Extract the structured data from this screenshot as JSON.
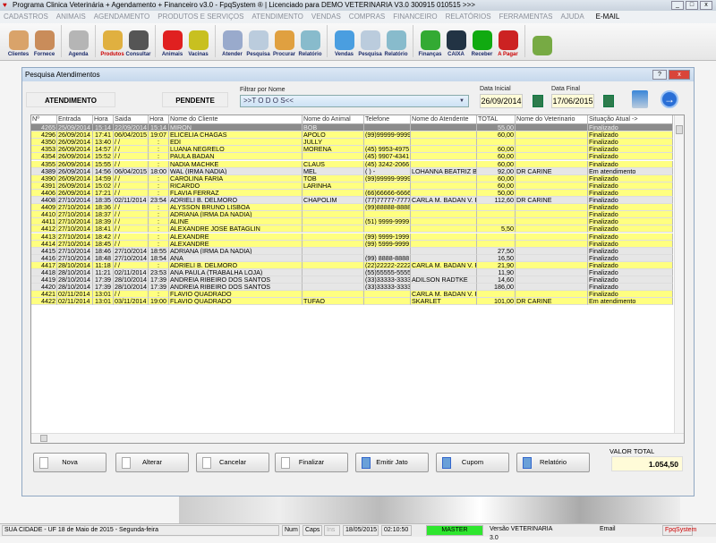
{
  "window": {
    "title": "Programa Clinica Veterinária + Agendamento + Financeiro v3.0 - FpqSystem ® | Licenciado para  DEMO VETERINARIA V3.0 300915 010515 >>>"
  },
  "menu": [
    "CADASTROS",
    "ANIMAIS",
    "AGENDAMENTO",
    "PRODUTOS E SERVIÇOS",
    "ATENDIMENTO",
    "VENDAS",
    "COMPRAS",
    "FINANCEIRO",
    "RELATÓRIOS",
    "FERRAMENTAS",
    "AJUDA"
  ],
  "menu_email": "E-MAIL",
  "toolbar": [
    {
      "label": "Clientes",
      "color": "#d9a36a"
    },
    {
      "label": "Fornece",
      "color": "#c98c5a"
    },
    {
      "sep": true
    },
    {
      "label": "Agenda",
      "color": "#b5b5b5"
    },
    {
      "sep": true
    },
    {
      "label": "Produtos",
      "color": "#e0b040",
      "red": true
    },
    {
      "label": "Consultar",
      "color": "#555"
    },
    {
      "sep": true
    },
    {
      "label": "Animais",
      "color": "#e02020"
    },
    {
      "label": "Vacinas",
      "color": "#c8c020"
    },
    {
      "sep": true
    },
    {
      "label": "Atender",
      "color": "#9ac"
    },
    {
      "label": "Pesquisa",
      "color": "#bcd"
    },
    {
      "label": "Procurar",
      "color": "#e0a040"
    },
    {
      "label": "Relatório",
      "color": "#8bc"
    },
    {
      "sep": true
    },
    {
      "label": "Vendas",
      "color": "#4a9ee0"
    },
    {
      "label": "Pesquisa",
      "color": "#bcd"
    },
    {
      "label": "Relatório",
      "color": "#8bc"
    },
    {
      "sep": true
    },
    {
      "label": "Finanças",
      "color": "#3a3"
    },
    {
      "label": "CAIXA",
      "color": "#234"
    },
    {
      "label": "Receber",
      "color": "#1a1"
    },
    {
      "label": "A Pagar",
      "color": "#c22",
      "red": true
    },
    {
      "sep": true
    },
    {
      "label": "",
      "color": "#7a4"
    }
  ],
  "dialog": {
    "title": "Pesquisa Atendimentos",
    "tab_atendimento": "ATENDIMENTO",
    "tab_pendente": "PENDENTE",
    "filter_label": "Filtrar por Nome",
    "filter_value": ">>T O D O S<<",
    "start_label": "Data Inicial",
    "start_date": "26/09/2014",
    "end_label": "Data Final",
    "end_date": "17/06/2015",
    "columns": [
      "Nº",
      "Entrada",
      "Hora",
      "Saida",
      "Hora",
      "Nome do Cliente",
      "Nome do Animal",
      "Telefone",
      "Nome do Atendente",
      "TOTAL",
      "Nome do Veterinario",
      "Situação Atual ->"
    ],
    "rows": [
      [
        "4265",
        "25/09/2014",
        "15:14",
        "22/09/2014",
        "15:14",
        "MIRON",
        "BOB",
        "",
        "",
        "55,00",
        "",
        "Finalizado",
        "sel"
      ],
      [
        "4296",
        "26/09/2014",
        "17:41",
        "06/04/2015",
        "19:07",
        "ELICELIA CHAGAS",
        "APOLO",
        "(99)99999-9999",
        "",
        "60,00",
        "",
        "Finalizado",
        "y"
      ],
      [
        "4350",
        "26/09/2014",
        "13:40",
        "/ /",
        ":",
        "EDI",
        "JULLY",
        "",
        "",
        "",
        "",
        "Finalizado",
        "y"
      ],
      [
        "4353",
        "26/09/2014",
        "14:57",
        "/ /",
        ":",
        "LUANA NEGRELO",
        "MORENA",
        "(45) 9953-4975",
        "",
        "60,00",
        "",
        "Finalizado",
        "y"
      ],
      [
        "4354",
        "26/09/2014",
        "15:52",
        "/ /",
        ":",
        "PAULA BADAN",
        "",
        "(45) 9907-4341",
        "",
        "60,00",
        "",
        "Finalizado",
        "y"
      ],
      [
        "4355",
        "26/09/2014",
        "15:55",
        "/ /",
        ":",
        "NADIA MACHKE",
        "CLAUS",
        "(45) 3242-2066",
        "",
        "60,00",
        "",
        "Finalizado",
        "y"
      ],
      [
        "4389",
        "26/09/2014",
        "14:56",
        "06/04/2015",
        "18:00",
        "WAL (IRMA NADIA)",
        "MEL",
        "(  )    -",
        "LOHANNA BEATRIZ BA",
        "92,00",
        "DR CARINE",
        "Em atendimento",
        "g"
      ],
      [
        "4390",
        "26/09/2014",
        "14:59",
        "/ /",
        ":",
        "CAROLINA FARIA",
        "TOB",
        "(99)99999-9999",
        "",
        "60,00",
        "",
        "Finalizado",
        "y"
      ],
      [
        "4391",
        "26/09/2014",
        "15:02",
        "/ /",
        ":",
        "RICARDO",
        "LARINHA",
        "",
        "",
        "60,00",
        "",
        "Finalizado",
        "y"
      ],
      [
        "4406",
        "26/09/2014",
        "17:21",
        "/ /",
        ":",
        "FLAVIA FERRAZ",
        "",
        "(66)66666-6666",
        "",
        "50,00",
        "",
        "Finalizado",
        "y"
      ],
      [
        "4408",
        "27/10/2014",
        "18:35",
        "02/11/2014",
        "23:54",
        "ADRIELI B. DELMORO",
        "CHAPOLIM",
        "(77)77777-7777",
        "CARLA M. BADAN V. R",
        "112,60",
        "DR CARINE",
        "Finalizado",
        "g"
      ],
      [
        "4409",
        "27/10/2014",
        "18:36",
        "/ /",
        ":",
        "ALYSSON BRUNO LISBOA",
        "",
        "(99)88888-8888",
        "",
        "",
        "",
        "Finalizado",
        "y"
      ],
      [
        "4410",
        "27/10/2014",
        "18:37",
        "/ /",
        ":",
        "ADRIANA (IRMA DA NADIA)",
        "",
        "",
        "",
        "",
        "",
        "Finalizado",
        "y"
      ],
      [
        "4411",
        "27/10/2014",
        "18:39",
        "/ /",
        ":",
        "ALINE",
        "",
        "(51) 9999-9999",
        "",
        "",
        "",
        "Finalizado",
        "y"
      ],
      [
        "4412",
        "27/10/2014",
        "18:41",
        "/ /",
        ":",
        "ALEXANDRE JOSE BATAGLIN",
        "",
        "",
        "",
        "5,50",
        "",
        "Finalizado",
        "y"
      ],
      [
        "4413",
        "27/10/2014",
        "18:42",
        "/ /",
        ":",
        "ALEXANDRE",
        "",
        "(99) 9999-1999",
        "",
        "",
        "",
        "Finalizado",
        "y"
      ],
      [
        "4414",
        "27/10/2014",
        "18:45",
        "/ /",
        ":",
        "ALEXANDRE",
        "",
        "(99) 5999-9999",
        "",
        "",
        "",
        "Finalizado",
        "y"
      ],
      [
        "4415",
        "27/10/2014",
        "18:46",
        "27/10/2014",
        "18:55",
        "ADRIANA (IRMA DA NADIA)",
        "",
        "",
        "",
        "27,50",
        "",
        "Finalizado",
        "g"
      ],
      [
        "4416",
        "27/10/2014",
        "18:48",
        "27/10/2014",
        "18:54",
        "ANA",
        "",
        "(99) 8888-8888",
        "",
        "16,50",
        "",
        "Finalizado",
        "g"
      ],
      [
        "4417",
        "28/10/2014",
        "11:18",
        "/ /",
        ":",
        "ADRIELI B. DELMORO",
        "",
        "(22)22222-2222",
        "CARLA M. BADAN V. R",
        "21,90",
        "",
        "Finalizado",
        "y"
      ],
      [
        "4418",
        "28/10/2014",
        "11:21",
        "02/11/2014",
        "23:53",
        "ANA PAULA (TRABALHA LOJA)",
        "",
        "(55)55555-5555",
        "",
        "11,90",
        "",
        "Finalizado",
        "g"
      ],
      [
        "4419",
        "28/10/2014",
        "17:39",
        "28/10/2014",
        "17:39",
        "ANDREIA RIBEIRO DOS SANTOS",
        "",
        "(33)33333-3333",
        "ADILSON RADTKE",
        "14,60",
        "",
        "Finalizado",
        "g"
      ],
      [
        "4420",
        "28/10/2014",
        "17:39",
        "28/10/2014",
        "17:39",
        "ANDREIA RIBEIRO DOS SANTOS",
        "",
        "(33)33333-3333",
        "",
        "186,00",
        "",
        "Finalizado",
        "g"
      ],
      [
        "4421",
        "02/11/2014",
        "13:01",
        "/ /",
        ":",
        "FLAVIO QUADRADO",
        "",
        "",
        "CARLA M. BADAN V. R",
        "",
        "",
        "Finalizado",
        "y"
      ],
      [
        "4422",
        "02/11/2014",
        "13:01",
        "03/11/2014",
        "19:00",
        "FLAVIO QUADRADO",
        "TUFAO",
        "",
        "SKARLET",
        "101,00",
        "DR CARINE",
        "Em atendimento",
        "y"
      ]
    ],
    "buttons": [
      "Nova",
      "Alterar",
      "Cancelar",
      "Finalizar",
      "Emitir Jato",
      "Cupom",
      "Relatório"
    ],
    "total_label": "VALOR TOTAL",
    "total_value": "1.054,50"
  },
  "status": {
    "city": "SUA CIDADE - UF 18 de Maio de 2015 - Segunda-feira",
    "num": "Num",
    "caps": "Caps",
    "ins": "Ins",
    "date": "18/05/2015",
    "time": "02:10:50",
    "user": "MASTER",
    "version": "Versão VETERINARIA 3.0",
    "email": "Email",
    "brand": "FpqSystem"
  }
}
